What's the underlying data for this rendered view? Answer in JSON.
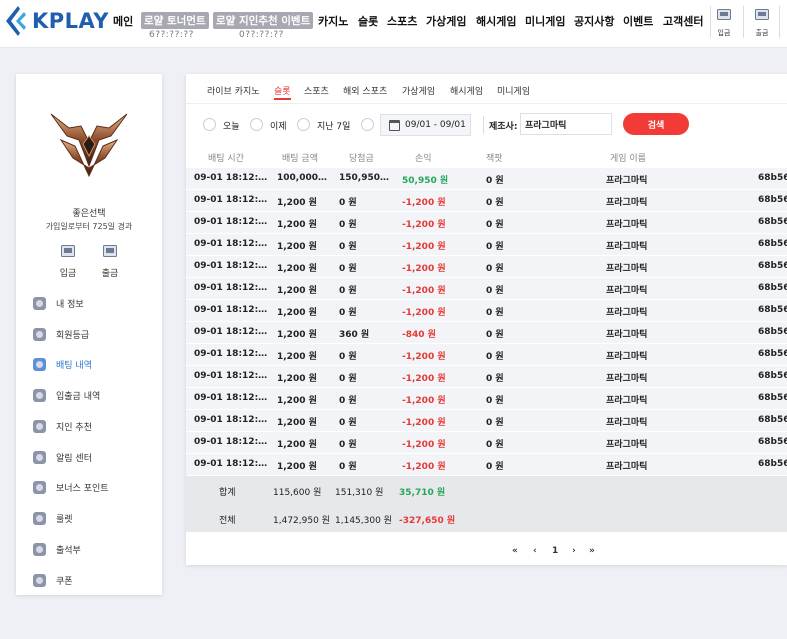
{
  "header": {
    "logo_text": "KPLAY",
    "nav": [
      {
        "label": "메인"
      },
      {
        "label": "로얄 토너먼트",
        "sub": "6??:??:??"
      },
      {
        "label": "로얄 지인추천 이벤트",
        "sub": "0??:??:??"
      },
      {
        "label": "카지노"
      },
      {
        "label": "슬롯"
      },
      {
        "label": "스포츠"
      },
      {
        "label": "가상게임"
      },
      {
        "label": "해시게임"
      },
      {
        "label": "미니게임"
      },
      {
        "label": "공지사항"
      },
      {
        "label": "이벤트"
      },
      {
        "label": "고객센터"
      }
    ],
    "deposit_label": "입금",
    "withdraw_label": "출금"
  },
  "sidebar": {
    "user_name": "좋은선택",
    "joined_text": "가입일로부터 725일 경과",
    "deposit_label": "입금",
    "withdraw_label": "출금",
    "menu": [
      {
        "label": "내 정보",
        "icon": "user-icon"
      },
      {
        "label": "회원등급",
        "icon": "grade-icon"
      },
      {
        "label": "배팅 내역",
        "icon": "betting-history-icon",
        "active": true
      },
      {
        "label": "입출금 내역",
        "icon": "wallet-icon"
      },
      {
        "label": "지인 추천",
        "icon": "referral-icon"
      },
      {
        "label": "알림 센터",
        "icon": "notification-icon"
      },
      {
        "label": "보너스 포인트",
        "icon": "bonus-icon"
      },
      {
        "label": "룰렛",
        "icon": "roulette-icon"
      },
      {
        "label": "출석부",
        "icon": "attendance-icon"
      },
      {
        "label": "쿠폰",
        "icon": "coupon-icon"
      }
    ]
  },
  "tabs": [
    {
      "label": "라이브 카지노"
    },
    {
      "label": "슬롯",
      "active": true
    },
    {
      "label": "스포츠"
    },
    {
      "label": "해외 스포츠"
    },
    {
      "label": "가상게임"
    },
    {
      "label": "해시게임"
    },
    {
      "label": "미니게임"
    }
  ],
  "filters": {
    "periods": [
      "오늘",
      "이제",
      "지난 7일",
      ""
    ],
    "date_range": "09/01 - 09/01",
    "maker_label": "제조사:",
    "maker_value": "프라그마틱",
    "search_label": "검색"
  },
  "table": {
    "columns": [
      "배팅 시간",
      "배팅 금액",
      "당첨금",
      "손익",
      "잭팟",
      "게임 이름"
    ],
    "rows": [
      {
        "time": "09-01 18:12:…",
        "bet": "100,000…",
        "win": "150,950…",
        "pl": "50,950 원",
        "pl_sign": "pos",
        "jackpot": "0 원",
        "game": "프라그마틱",
        "id": "68b56"
      },
      {
        "time": "09-01 18:12:…",
        "bet": "1,200 원",
        "win": "0 원",
        "pl": "-1,200 원",
        "pl_sign": "neg",
        "jackpot": "0 원",
        "game": "프라그마틱",
        "id": "68b56"
      },
      {
        "time": "09-01 18:12:…",
        "bet": "1,200 원",
        "win": "0 원",
        "pl": "-1,200 원",
        "pl_sign": "neg",
        "jackpot": "0 원",
        "game": "프라그마틱",
        "id": "68b56"
      },
      {
        "time": "09-01 18:12:…",
        "bet": "1,200 원",
        "win": "0 원",
        "pl": "-1,200 원",
        "pl_sign": "neg",
        "jackpot": "0 원",
        "game": "프라그마틱",
        "id": "68b56"
      },
      {
        "time": "09-01 18:12:…",
        "bet": "1,200 원",
        "win": "0 원",
        "pl": "-1,200 원",
        "pl_sign": "neg",
        "jackpot": "0 원",
        "game": "프라그마틱",
        "id": "68b56"
      },
      {
        "time": "09-01 18:12:…",
        "bet": "1,200 원",
        "win": "0 원",
        "pl": "-1,200 원",
        "pl_sign": "neg",
        "jackpot": "0 원",
        "game": "프라그마틱",
        "id": "68b56"
      },
      {
        "time": "09-01 18:12:…",
        "bet": "1,200 원",
        "win": "0 원",
        "pl": "-1,200 원",
        "pl_sign": "neg",
        "jackpot": "0 원",
        "game": "프라그마틱",
        "id": "68b56"
      },
      {
        "time": "09-01 18:12:…",
        "bet": "1,200 원",
        "win": "360 원",
        "pl": "-840 원",
        "pl_sign": "neg",
        "jackpot": "0 원",
        "game": "프라그마틱",
        "id": "68b56"
      },
      {
        "time": "09-01 18:12:…",
        "bet": "1,200 원",
        "win": "0 원",
        "pl": "-1,200 원",
        "pl_sign": "neg",
        "jackpot": "0 원",
        "game": "프라그마틱",
        "id": "68b56"
      },
      {
        "time": "09-01 18:12:…",
        "bet": "1,200 원",
        "win": "0 원",
        "pl": "-1,200 원",
        "pl_sign": "neg",
        "jackpot": "0 원",
        "game": "프라그마틱",
        "id": "68b56"
      },
      {
        "time": "09-01 18:12:…",
        "bet": "1,200 원",
        "win": "0 원",
        "pl": "-1,200 원",
        "pl_sign": "neg",
        "jackpot": "0 원",
        "game": "프라그마틱",
        "id": "68b56"
      },
      {
        "time": "09-01 18:12:…",
        "bet": "1,200 원",
        "win": "0 원",
        "pl": "-1,200 원",
        "pl_sign": "neg",
        "jackpot": "0 원",
        "game": "프라그마틱",
        "id": "68b56"
      },
      {
        "time": "09-01 18:12:…",
        "bet": "1,200 원",
        "win": "0 원",
        "pl": "-1,200 원",
        "pl_sign": "neg",
        "jackpot": "0 원",
        "game": "프라그마틱",
        "id": "68b56"
      },
      {
        "time": "09-01 18:12:…",
        "bet": "1,200 원",
        "win": "0 원",
        "pl": "-1,200 원",
        "pl_sign": "neg",
        "jackpot": "0 원",
        "game": "프라그마틱",
        "id": "68b56"
      }
    ],
    "summary": [
      {
        "label": "합계",
        "bet": "115,600 원",
        "win": "151,310 원",
        "pl": "35,710 원",
        "pl_sign": "pos"
      },
      {
        "label": "전체",
        "bet": "1,472,950 원",
        "win": "1,145,300 원",
        "pl": "-327,650 원",
        "pl_sign": "neg"
      }
    ]
  },
  "pagination": {
    "first": "«",
    "prev": "‹",
    "page": "1",
    "next": "›",
    "last": "»"
  },
  "colors": {
    "brand": "#1f5fae",
    "accent_red": "#f23b36",
    "loss": "#e53935",
    "profit": "#26a65b"
  }
}
